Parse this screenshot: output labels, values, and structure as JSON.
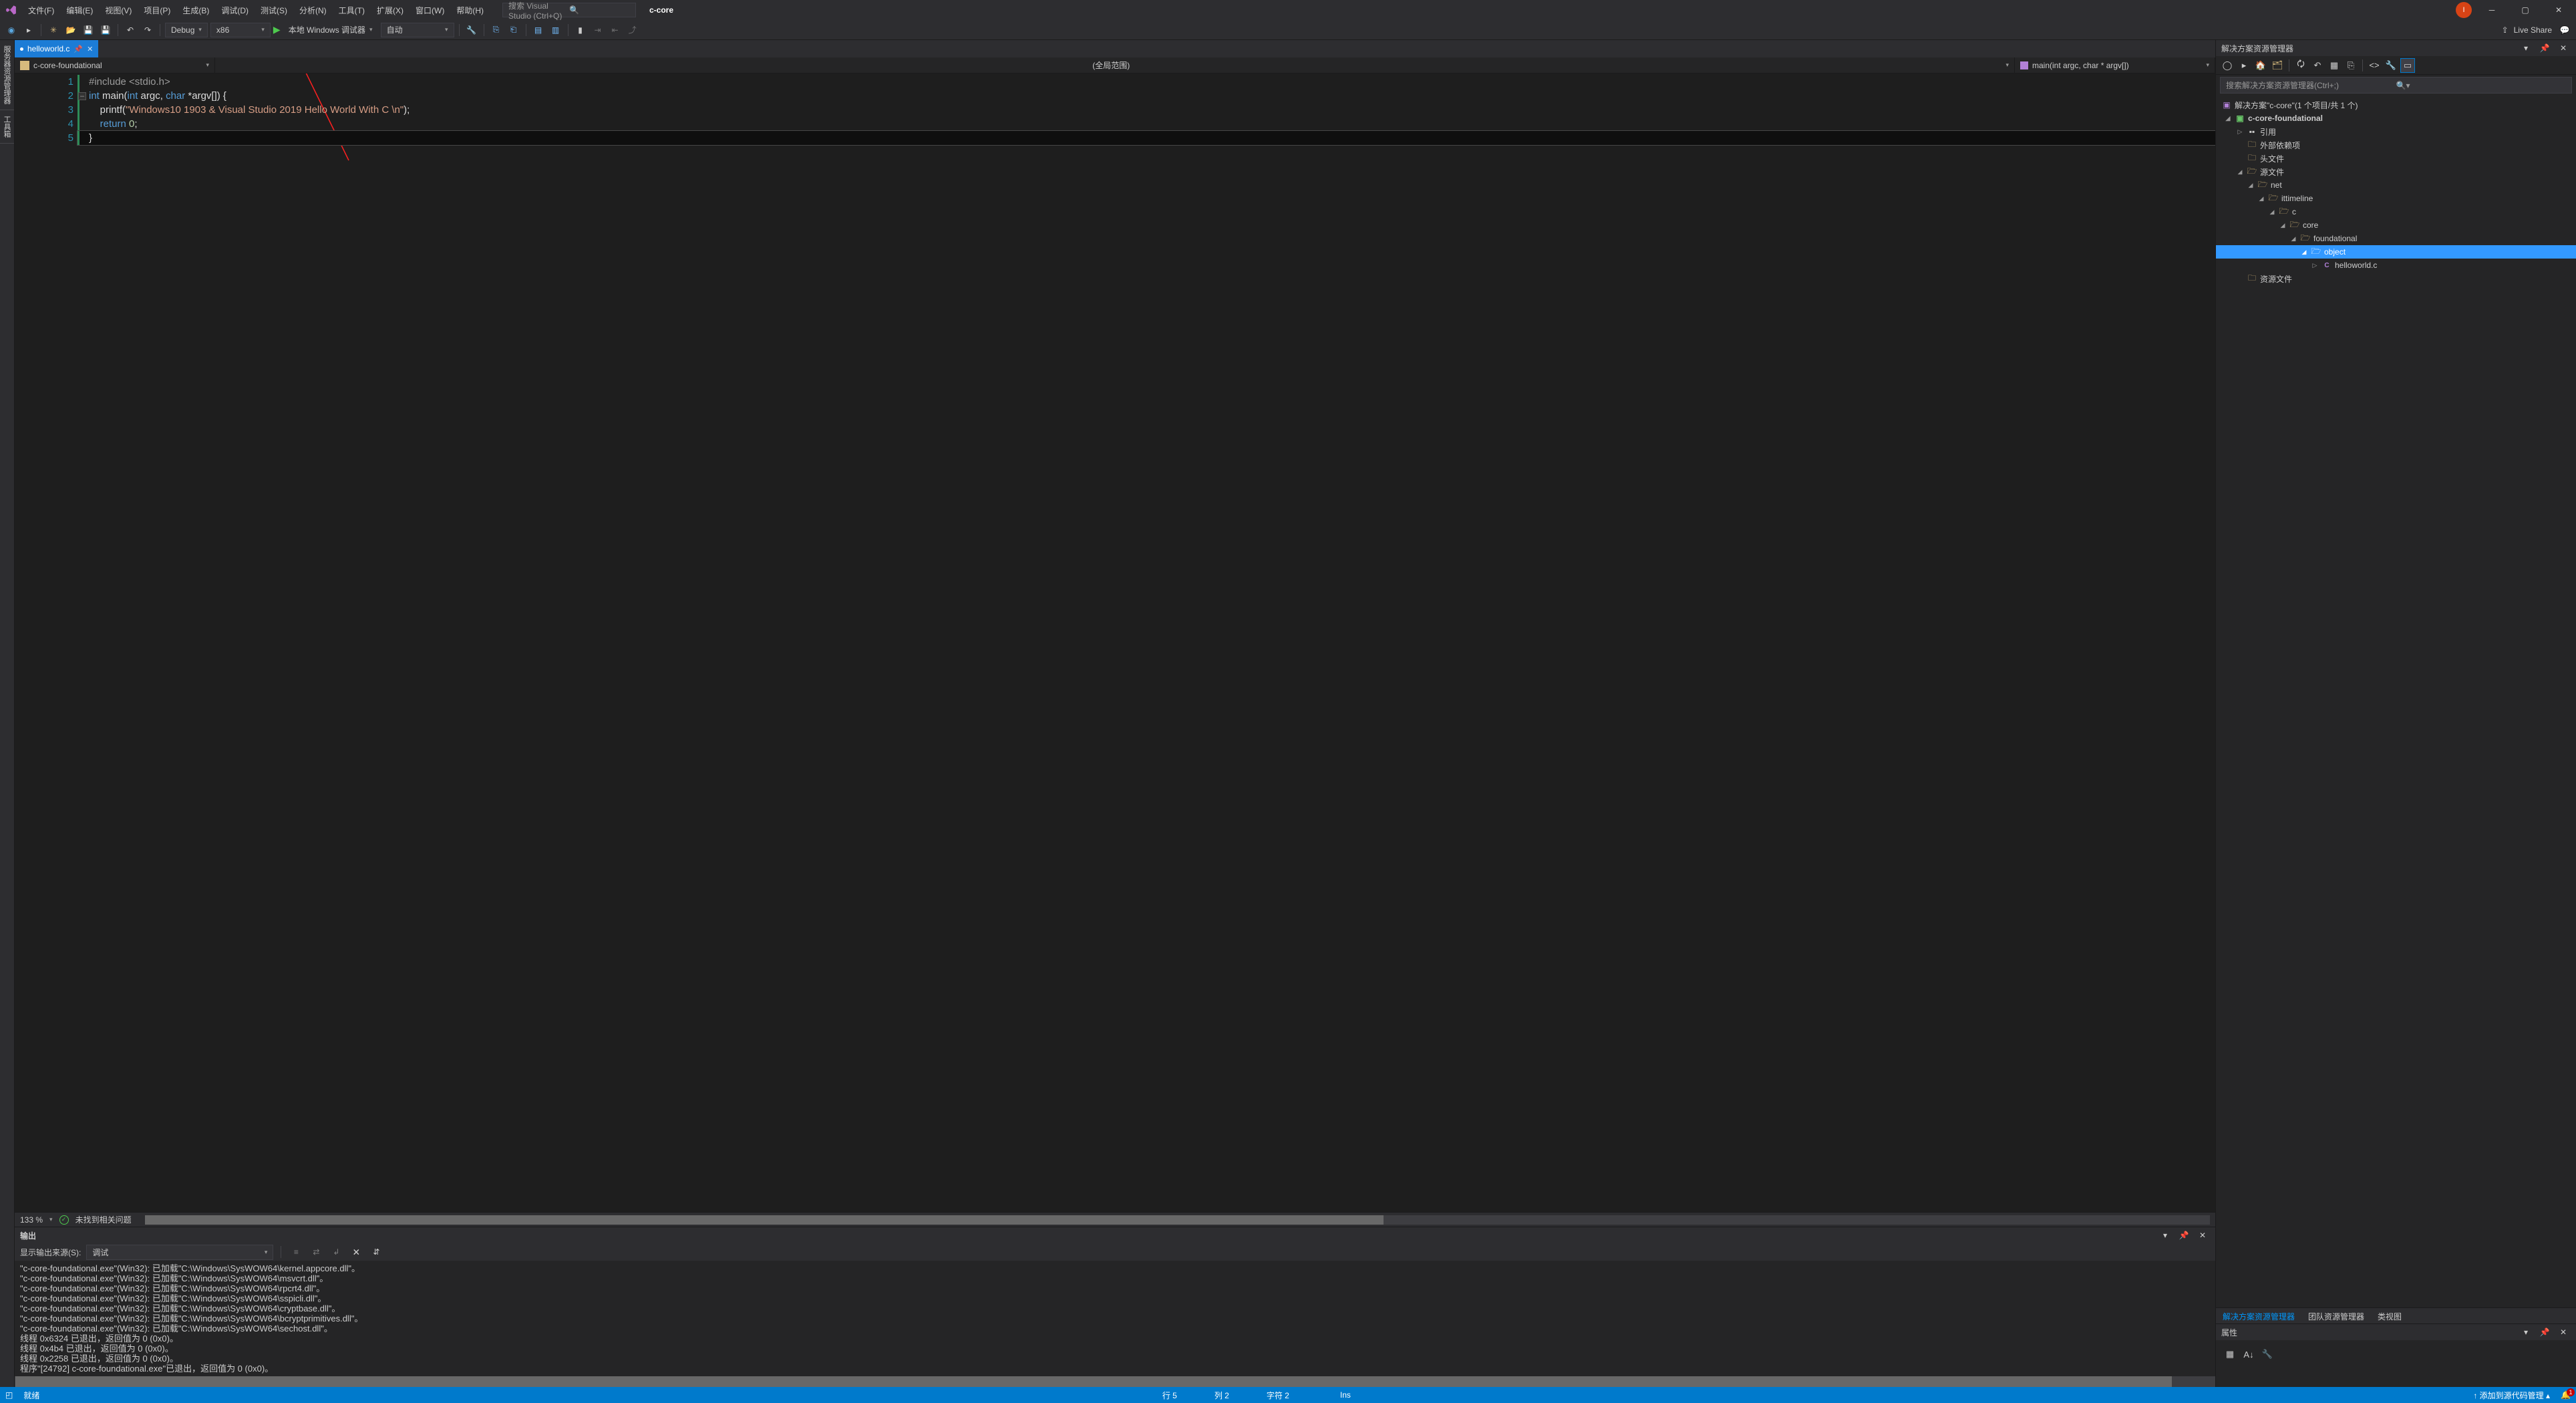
{
  "titlebar": {
    "menus": [
      "文件(F)",
      "编辑(E)",
      "视图(V)",
      "项目(P)",
      "生成(B)",
      "调试(D)",
      "测试(S)",
      "分析(N)",
      "工具(T)",
      "扩展(X)",
      "窗口(W)",
      "帮助(H)"
    ],
    "search_placeholder": "搜索 Visual Studio (Ctrl+Q)",
    "solution_name": "c-core",
    "user_initial": "I"
  },
  "toolbar": {
    "config": "Debug",
    "platform": "x86",
    "debugger": "本地 Windows 调试器",
    "auto": "自动",
    "live_share": "Live Share"
  },
  "side_tabs": [
    "服务器资源管理器",
    "工具箱"
  ],
  "doc_tab": {
    "name": "helloworld.c"
  },
  "navbar": {
    "left": "c-core-foundational",
    "mid": "(全局范围)",
    "right": "main(int argc, char * argv[])"
  },
  "code": {
    "lines": [
      "1",
      "2",
      "3",
      "4",
      "5"
    ],
    "l1_inc": "#include ",
    "l1_hdr": "<stdio.h>",
    "l2_kw1": "int",
    "l2_fn": " main(",
    "l2_kw2": "int",
    "l2_p1": " argc, ",
    "l2_kw3": "char",
    "l2_p2": " *argv[]) {",
    "l3_indent": "    ",
    "l3_fn": "printf",
    "l3_open": "(",
    "l3_str": "\"Windows10 1903 & Visual Studio 2019 Hello World With C \\n\"",
    "l3_close": ");",
    "l4_indent": "    ",
    "l4_kw": "return",
    "l4_sp": " ",
    "l4_num": "0",
    "l4_semi": ";",
    "l5": "}"
  },
  "editor_status": {
    "zoom": "133 %",
    "problems": "未找到相关问题"
  },
  "output": {
    "title": "输出",
    "source_label": "显示输出来源(S):",
    "source_value": "调试",
    "lines": [
      "\"c-core-foundational.exe\"(Win32): 已加载\"C:\\Windows\\SysWOW64\\kernel.appcore.dll\"。",
      "\"c-core-foundational.exe\"(Win32): 已加载\"C:\\Windows\\SysWOW64\\msvcrt.dll\"。",
      "\"c-core-foundational.exe\"(Win32): 已加载\"C:\\Windows\\SysWOW64\\rpcrt4.dll\"。",
      "\"c-core-foundational.exe\"(Win32): 已加载\"C:\\Windows\\SysWOW64\\sspicli.dll\"。",
      "\"c-core-foundational.exe\"(Win32): 已加载\"C:\\Windows\\SysWOW64\\cryptbase.dll\"。",
      "\"c-core-foundational.exe\"(Win32): 已加载\"C:\\Windows\\SysWOW64\\bcryptprimitives.dll\"。",
      "\"c-core-foundational.exe\"(Win32): 已加载\"C:\\Windows\\SysWOW64\\sechost.dll\"。",
      "线程 0x6324 已退出，返回值为 0 (0x0)。",
      "线程 0x4b4 已退出，返回值为 0 (0x0)。",
      "线程 0x2258 已退出，返回值为 0 (0x0)。",
      "程序\"[24792] c-core-foundational.exe\"已退出，返回值为 0 (0x0)。"
    ]
  },
  "explorer": {
    "title": "解决方案资源管理器",
    "search_placeholder": "搜索解决方案资源管理器(Ctrl+;)",
    "solution_label": "解决方案\"c-core\"(1 个项目/共 1 个)",
    "project": "c-core-foundational",
    "refs": "引用",
    "ext_deps": "外部依赖项",
    "headers": "头文件",
    "sources": "源文件",
    "net": "net",
    "ittimeline": "ittimeline",
    "c_folder": "c",
    "core": "core",
    "foundational": "foundational",
    "object": "object",
    "helloworld": "helloworld.c",
    "resources": "资源文件"
  },
  "right_tabs": [
    "解决方案资源管理器",
    "团队资源管理器",
    "类视图"
  ],
  "properties": {
    "title": "属性"
  },
  "statusbar": {
    "ready": "就绪",
    "line": "行 5",
    "col": "列 2",
    "char": "字符 2",
    "ins": "Ins",
    "source_control": "添加到源代码管理",
    "notif_count": "1"
  }
}
